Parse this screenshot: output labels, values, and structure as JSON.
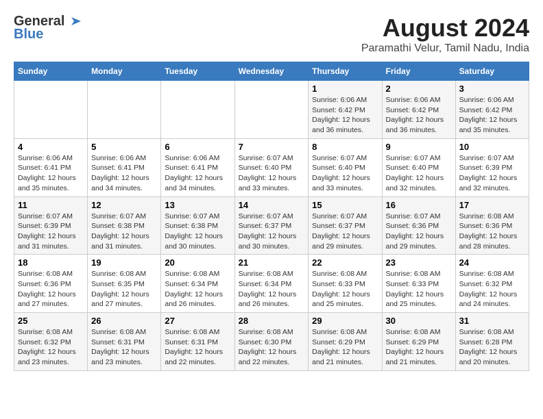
{
  "header": {
    "logo_general": "General",
    "logo_blue": "Blue",
    "month_title": "August 2024",
    "location": "Paramathi Velur, Tamil Nadu, India"
  },
  "weekdays": [
    "Sunday",
    "Monday",
    "Tuesday",
    "Wednesday",
    "Thursday",
    "Friday",
    "Saturday"
  ],
  "weeks": [
    [
      {
        "day": "",
        "info": ""
      },
      {
        "day": "",
        "info": ""
      },
      {
        "day": "",
        "info": ""
      },
      {
        "day": "",
        "info": ""
      },
      {
        "day": "1",
        "info": "Sunrise: 6:06 AM\nSunset: 6:42 PM\nDaylight: 12 hours\nand 36 minutes."
      },
      {
        "day": "2",
        "info": "Sunrise: 6:06 AM\nSunset: 6:42 PM\nDaylight: 12 hours\nand 36 minutes."
      },
      {
        "day": "3",
        "info": "Sunrise: 6:06 AM\nSunset: 6:42 PM\nDaylight: 12 hours\nand 35 minutes."
      }
    ],
    [
      {
        "day": "4",
        "info": "Sunrise: 6:06 AM\nSunset: 6:41 PM\nDaylight: 12 hours\nand 35 minutes."
      },
      {
        "day": "5",
        "info": "Sunrise: 6:06 AM\nSunset: 6:41 PM\nDaylight: 12 hours\nand 34 minutes."
      },
      {
        "day": "6",
        "info": "Sunrise: 6:06 AM\nSunset: 6:41 PM\nDaylight: 12 hours\nand 34 minutes."
      },
      {
        "day": "7",
        "info": "Sunrise: 6:07 AM\nSunset: 6:40 PM\nDaylight: 12 hours\nand 33 minutes."
      },
      {
        "day": "8",
        "info": "Sunrise: 6:07 AM\nSunset: 6:40 PM\nDaylight: 12 hours\nand 33 minutes."
      },
      {
        "day": "9",
        "info": "Sunrise: 6:07 AM\nSunset: 6:40 PM\nDaylight: 12 hours\nand 32 minutes."
      },
      {
        "day": "10",
        "info": "Sunrise: 6:07 AM\nSunset: 6:39 PM\nDaylight: 12 hours\nand 32 minutes."
      }
    ],
    [
      {
        "day": "11",
        "info": "Sunrise: 6:07 AM\nSunset: 6:39 PM\nDaylight: 12 hours\nand 31 minutes."
      },
      {
        "day": "12",
        "info": "Sunrise: 6:07 AM\nSunset: 6:38 PM\nDaylight: 12 hours\nand 31 minutes."
      },
      {
        "day": "13",
        "info": "Sunrise: 6:07 AM\nSunset: 6:38 PM\nDaylight: 12 hours\nand 30 minutes."
      },
      {
        "day": "14",
        "info": "Sunrise: 6:07 AM\nSunset: 6:37 PM\nDaylight: 12 hours\nand 30 minutes."
      },
      {
        "day": "15",
        "info": "Sunrise: 6:07 AM\nSunset: 6:37 PM\nDaylight: 12 hours\nand 29 minutes."
      },
      {
        "day": "16",
        "info": "Sunrise: 6:07 AM\nSunset: 6:36 PM\nDaylight: 12 hours\nand 29 minutes."
      },
      {
        "day": "17",
        "info": "Sunrise: 6:08 AM\nSunset: 6:36 PM\nDaylight: 12 hours\nand 28 minutes."
      }
    ],
    [
      {
        "day": "18",
        "info": "Sunrise: 6:08 AM\nSunset: 6:36 PM\nDaylight: 12 hours\nand 27 minutes."
      },
      {
        "day": "19",
        "info": "Sunrise: 6:08 AM\nSunset: 6:35 PM\nDaylight: 12 hours\nand 27 minutes."
      },
      {
        "day": "20",
        "info": "Sunrise: 6:08 AM\nSunset: 6:34 PM\nDaylight: 12 hours\nand 26 minutes."
      },
      {
        "day": "21",
        "info": "Sunrise: 6:08 AM\nSunset: 6:34 PM\nDaylight: 12 hours\nand 26 minutes."
      },
      {
        "day": "22",
        "info": "Sunrise: 6:08 AM\nSunset: 6:33 PM\nDaylight: 12 hours\nand 25 minutes."
      },
      {
        "day": "23",
        "info": "Sunrise: 6:08 AM\nSunset: 6:33 PM\nDaylight: 12 hours\nand 25 minutes."
      },
      {
        "day": "24",
        "info": "Sunrise: 6:08 AM\nSunset: 6:32 PM\nDaylight: 12 hours\nand 24 minutes."
      }
    ],
    [
      {
        "day": "25",
        "info": "Sunrise: 6:08 AM\nSunset: 6:32 PM\nDaylight: 12 hours\nand 23 minutes."
      },
      {
        "day": "26",
        "info": "Sunrise: 6:08 AM\nSunset: 6:31 PM\nDaylight: 12 hours\nand 23 minutes."
      },
      {
        "day": "27",
        "info": "Sunrise: 6:08 AM\nSunset: 6:31 PM\nDaylight: 12 hours\nand 22 minutes."
      },
      {
        "day": "28",
        "info": "Sunrise: 6:08 AM\nSunset: 6:30 PM\nDaylight: 12 hours\nand 22 minutes."
      },
      {
        "day": "29",
        "info": "Sunrise: 6:08 AM\nSunset: 6:29 PM\nDaylight: 12 hours\nand 21 minutes."
      },
      {
        "day": "30",
        "info": "Sunrise: 6:08 AM\nSunset: 6:29 PM\nDaylight: 12 hours\nand 21 minutes."
      },
      {
        "day": "31",
        "info": "Sunrise: 6:08 AM\nSunset: 6:28 PM\nDaylight: 12 hours\nand 20 minutes."
      }
    ]
  ]
}
